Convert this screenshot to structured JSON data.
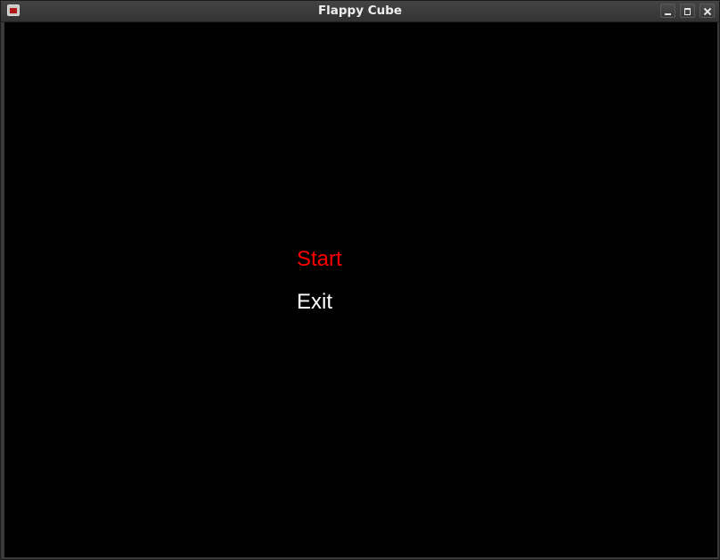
{
  "window": {
    "title": "Flappy Cube",
    "icon": "app-window-icon"
  },
  "menu": {
    "items": [
      {
        "label": "Start",
        "selected": true,
        "color": "#ff0000"
      },
      {
        "label": "Exit",
        "selected": false,
        "color": "#ffffff"
      }
    ]
  },
  "colors": {
    "background": "#000000",
    "titlebar": "#3a3a3a",
    "highlight": "#ff0000",
    "text": "#ffffff"
  }
}
